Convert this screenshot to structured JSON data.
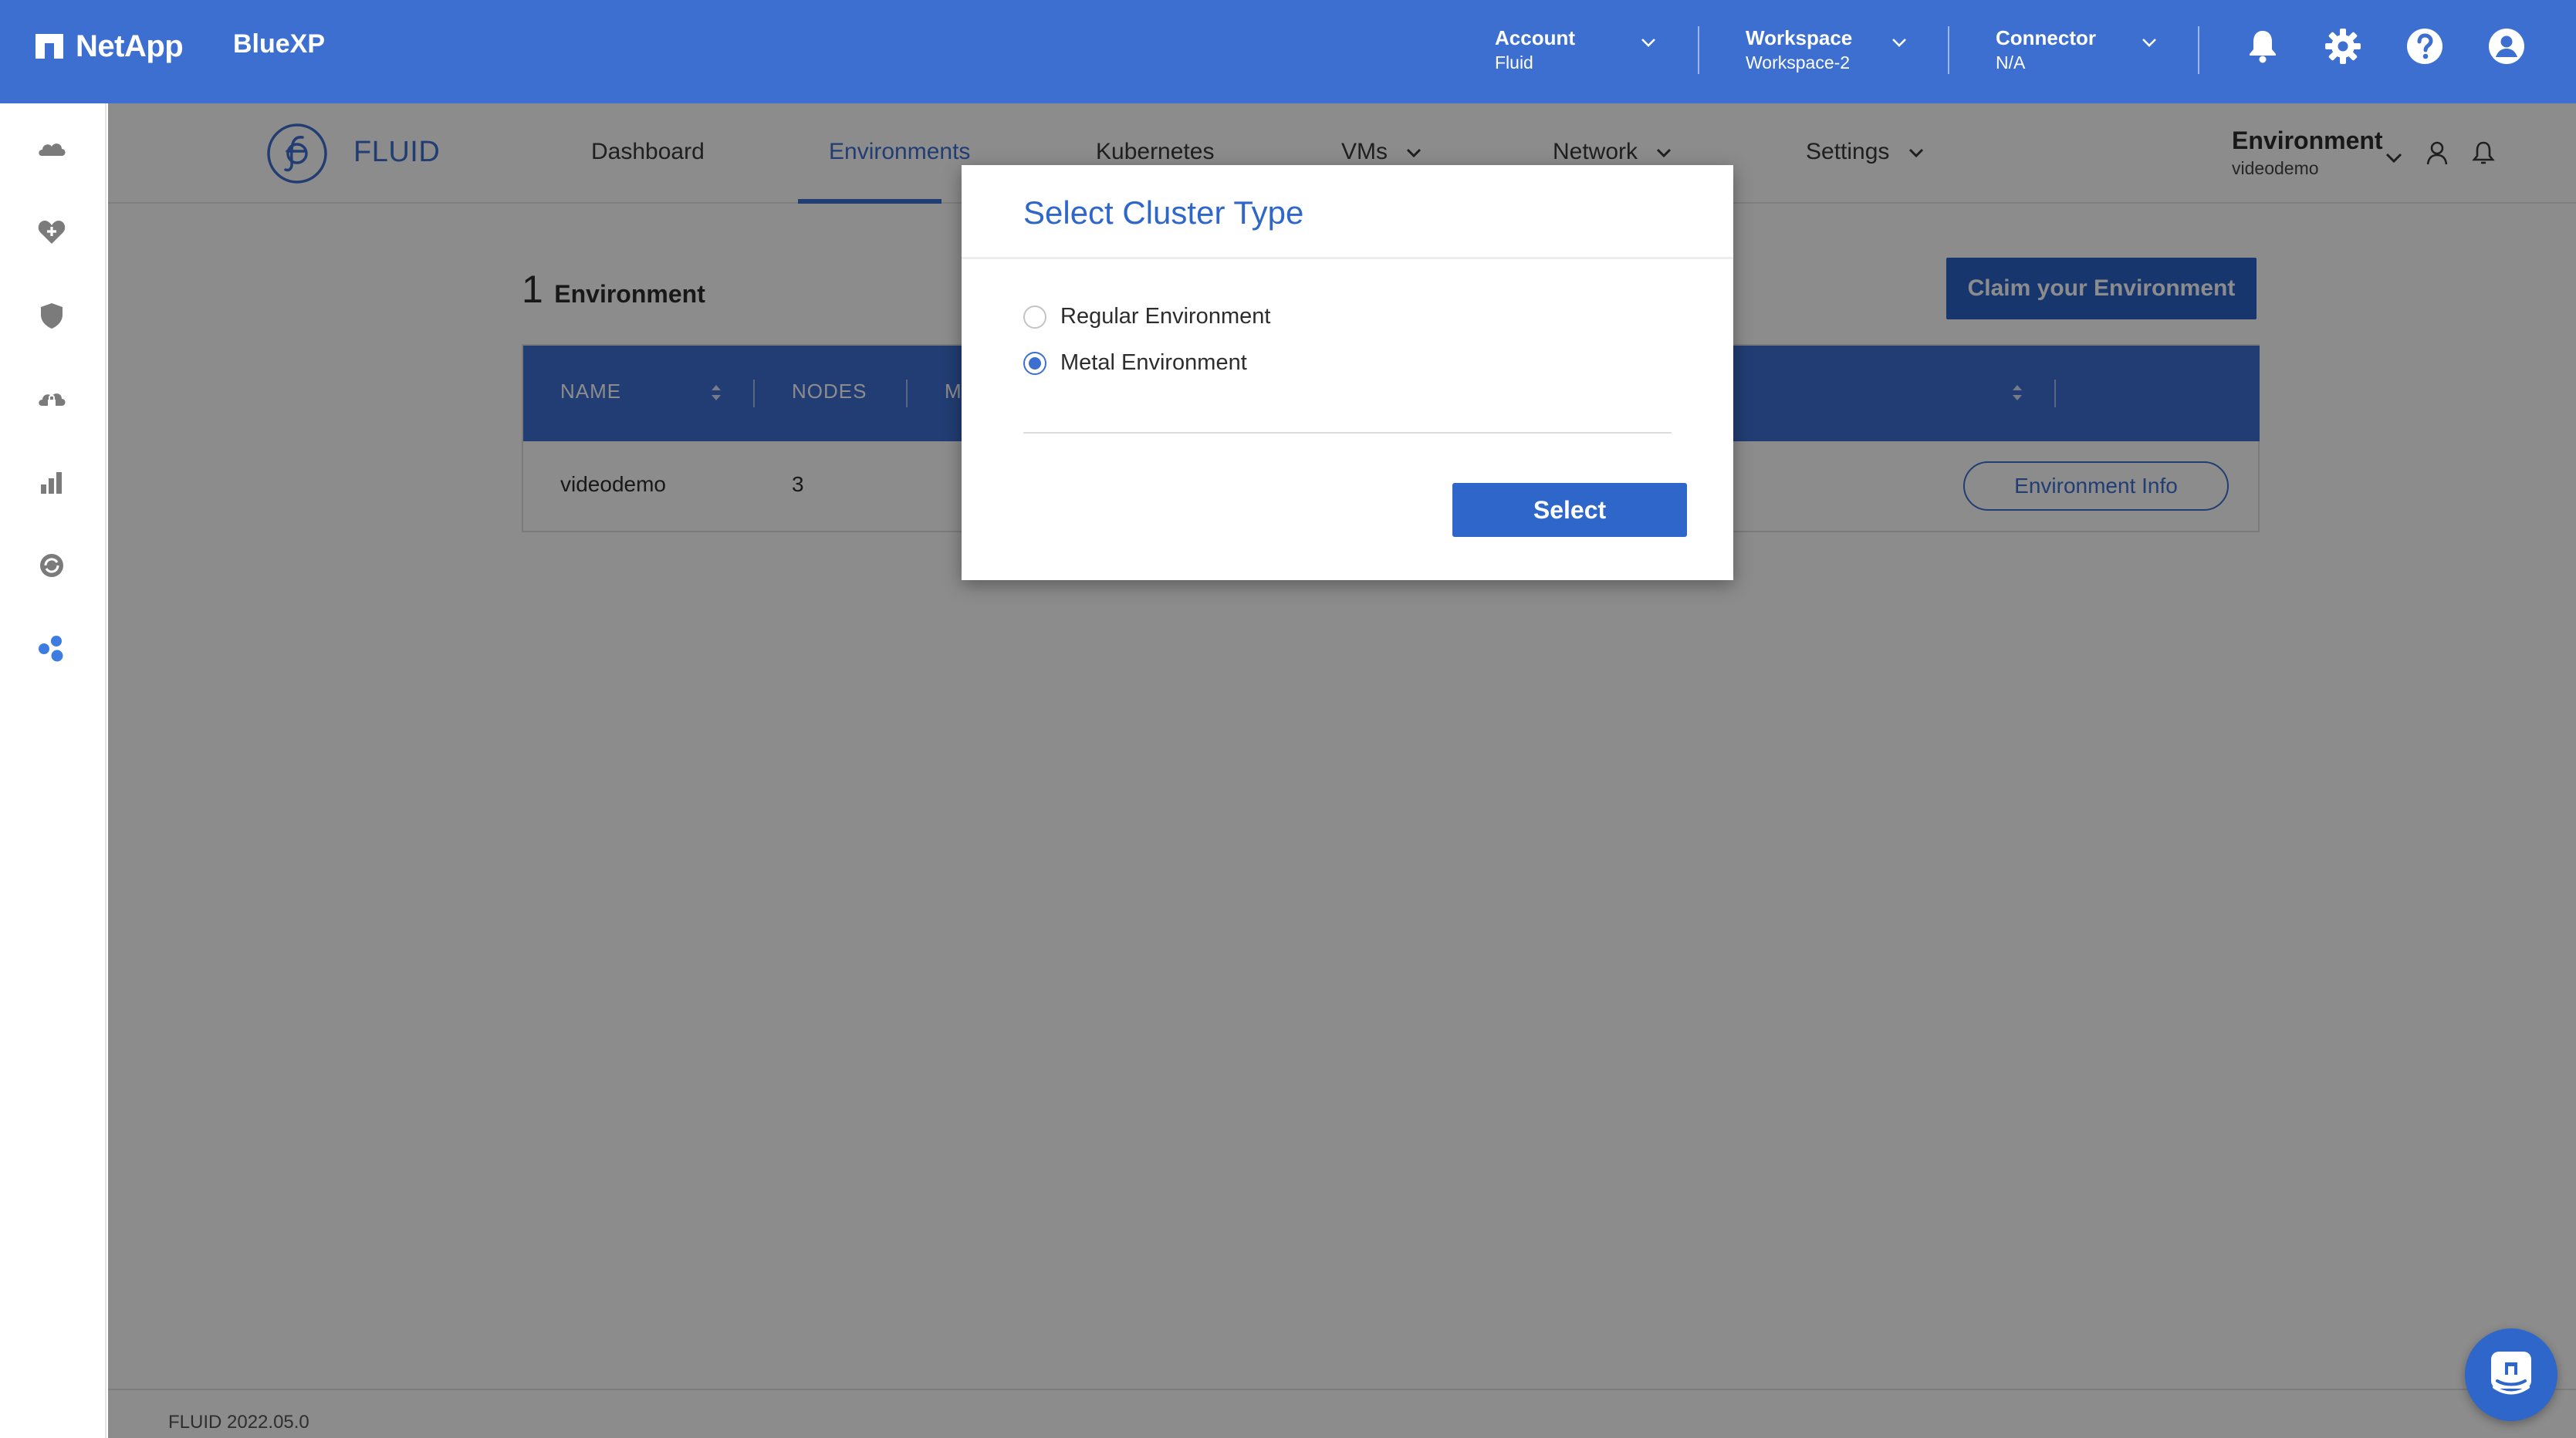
{
  "topbar": {
    "brand_name": "NetApp",
    "product": "BlueXP",
    "account": {
      "label": "Account",
      "value": "Fluid"
    },
    "workspace": {
      "label": "Workspace",
      "value": "Workspace-2"
    },
    "connector": {
      "label": "Connector",
      "value": "N/A"
    },
    "icons": [
      "bell-icon",
      "gear-icon",
      "help-icon",
      "user-icon"
    ],
    "color": "#3d6fd1"
  },
  "leftrail": {
    "icons": [
      "cloud-icon",
      "health-icon",
      "shield-icon",
      "cloud-lock-icon",
      "bar-chart-icon",
      "sync-icon",
      "apps-icon"
    ],
    "active_icon": "apps-icon"
  },
  "subnav": {
    "app_name": "FLUID",
    "tabs": [
      {
        "label": "Dashboard"
      },
      {
        "label": "Environments",
        "active": true
      },
      {
        "label": "Kubernetes"
      },
      {
        "label": "VMs"
      },
      {
        "label": "Network"
      },
      {
        "label": "Settings"
      }
    ],
    "environment": {
      "label": "Environment",
      "value": "videodemo"
    }
  },
  "content": {
    "count": "1",
    "count_label": "Environment",
    "claim_button": "Claim your Environment",
    "table": {
      "headers": [
        "NAME",
        "NODES",
        "M"
      ],
      "rows": [
        {
          "name": "videodemo",
          "nodes": "3",
          "action": "Environment Info"
        }
      ]
    }
  },
  "footer": {
    "version": "FLUID 2022.05.0"
  },
  "modal": {
    "title": "Select Cluster Type",
    "options": [
      {
        "label": "Regular Environment",
        "checked": false
      },
      {
        "label": "Metal Environment",
        "checked": true
      }
    ],
    "submit": "Select"
  },
  "accent": "#2f66c9"
}
